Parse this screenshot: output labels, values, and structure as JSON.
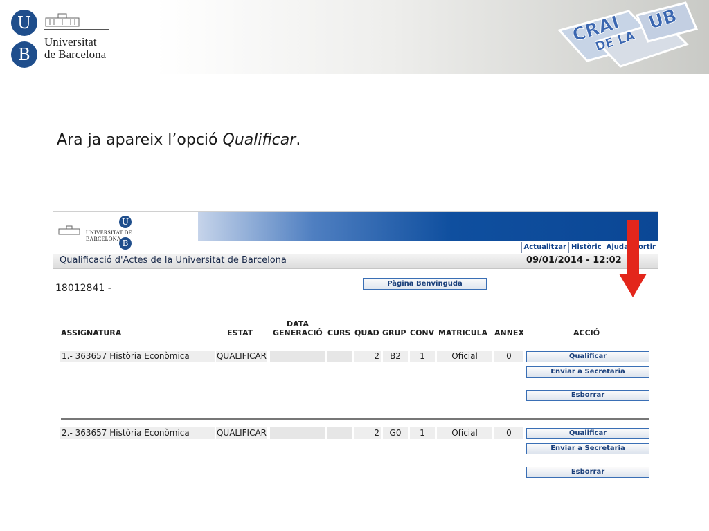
{
  "slide": {
    "university_name_line1": "Universitat",
    "university_name_line2": "de Barcelona",
    "ub_letter_u": "U",
    "ub_letter_b": "B",
    "crai_logo_text_top": "CRAI",
    "crai_logo_text_middle": "DE LA",
    "crai_logo_text_right": "UB",
    "caption_prefix": "Ara ja apareix l’opció ",
    "caption_emphasis": "Qualificar",
    "caption_suffix": "."
  },
  "app": {
    "banner_logo_text": "UNIVERSITAT DE BARCELONA",
    "banner_letter_u": "U",
    "banner_letter_b": "B",
    "top_links": [
      "Actualitzar",
      "Històric",
      "Ajuda",
      "Sortir"
    ],
    "title": "Qualificació d'Actes de la Universitat de Barcelona",
    "datetime": "09/01/2014 - 12:02",
    "user_code": "18012841 -",
    "welcome_button": "Pàgina Benvinguda",
    "columns": {
      "assignatura": "ASSIGNATURA",
      "estat": "ESTAT",
      "data_generacio_1": "DATA",
      "data_generacio_2": "GENERACIÓ",
      "curs": "CURS",
      "quad": "QUAD",
      "grup": "GRUP",
      "conv": "CONV",
      "matricula": "MATRICULA",
      "annex": "ANNEX",
      "accio": "ACCIÓ"
    },
    "rows": [
      {
        "assignatura": "1.- 363657 Història Econòmica",
        "estat": "QUALIFICAR",
        "quad": "2",
        "grup": "B2",
        "conv": "1",
        "matricula": "Oficial",
        "annex": "0",
        "actions": [
          "Qualificar",
          "Enviar a Secretaria",
          "Esborrar"
        ]
      },
      {
        "assignatura": "2.- 363657 Història Econòmica",
        "estat": "QUALIFICAR",
        "quad": "2",
        "grup": "G0",
        "conv": "1",
        "matricula": "Oficial",
        "annex": "0",
        "actions": [
          "Qualificar",
          "Enviar a Secretaria",
          "Esborrar"
        ]
      }
    ]
  },
  "annotation": {
    "arrow_icon": "red-down-arrow-icon",
    "arrow_color": "#e3261b"
  },
  "colors": {
    "ub_blue": "#1f4e8c",
    "banner_blue": "#0b4795",
    "button_text": "#1a3f7a"
  }
}
